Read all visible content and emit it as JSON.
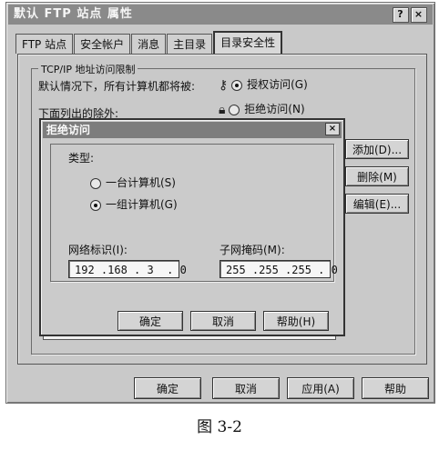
{
  "window": {
    "title": "默认 FTP 站点 属性",
    "help_btn": "?",
    "close_btn": "×"
  },
  "tabs": [
    {
      "label": "FTP 站点"
    },
    {
      "label": "安全帐户"
    },
    {
      "label": "消息"
    },
    {
      "label": "主目录"
    },
    {
      "label": "目录安全性"
    }
  ],
  "group": {
    "legend": "TCP/IP 地址访问限制",
    "default_text": "默认情况下，所有计算机都将被:",
    "grant_label": "授权访问(G)",
    "deny_label": "拒绝访问(N)",
    "except_text": "下面列出的除外:"
  },
  "side_buttons": {
    "add": "添加(D)...",
    "remove": "删除(M)",
    "edit": "编辑(E)..."
  },
  "dialog": {
    "title": "拒绝访问",
    "close": "×",
    "type_label": "类型:",
    "single_label": "一台计算机(S)",
    "group_label": "一组计算机(G)",
    "network_id_label": "网络标识(I):",
    "network_id_value": "192 .168 . 3  . 0",
    "subnet_label": "子网掩码(M):",
    "subnet_value": "255 .255 .255 . 0",
    "ok": "确定",
    "cancel": "取消",
    "help": "帮助(H)"
  },
  "bottom_buttons": {
    "ok": "确定",
    "cancel": "取消",
    "apply": "应用(A)",
    "help": "帮助"
  },
  "caption": "图 3-2"
}
